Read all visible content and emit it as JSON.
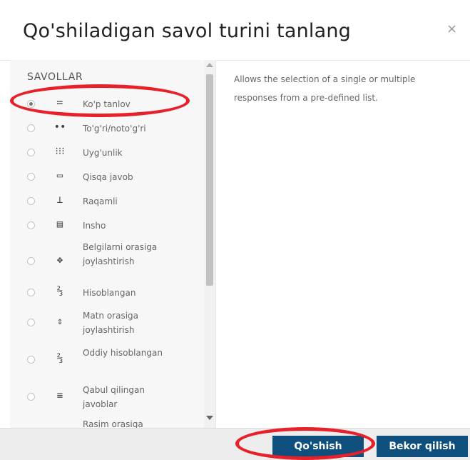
{
  "dialog": {
    "title": "Qo'shiladigan savol turini tanlang",
    "close_icon": "×"
  },
  "options_section": {
    "label": "SAVOLLAR",
    "items": [
      {
        "label": "Ko'p tanlov",
        "icon": "≔",
        "selected": true
      },
      {
        "label": "To'g'ri/noto'g'ri",
        "icon": "••",
        "selected": false
      },
      {
        "label": "Uyg'unlik",
        "icon": "⁝⁝⁝",
        "selected": false
      },
      {
        "label": "Qisqa javob",
        "icon": "▭",
        "selected": false
      },
      {
        "label": "Raqamli",
        "icon": "⊥",
        "selected": false
      },
      {
        "label": "Insho",
        "icon": "▤",
        "selected": false
      },
      {
        "label": "Belgilarni orasiga joylashtirish",
        "icon": "✥",
        "selected": false
      },
      {
        "label": "Hisoblangan",
        "icon": "⅔",
        "selected": false
      },
      {
        "label": "Matn orasiga joylashtirish",
        "icon": "⇕",
        "selected": false
      },
      {
        "label": "Oddiy hisoblangan",
        "icon": "⅔",
        "selected": false
      },
      {
        "label": "Qabul qilingan javoblar",
        "icon": "≡",
        "selected": false
      },
      {
        "label": "Rasim orasiga",
        "icon": "",
        "selected": false
      }
    ]
  },
  "description": "Allows the selection of a single or multiple responses from a pre-defined list.",
  "footer": {
    "add_label": "Qo'shish",
    "cancel_label": "Bekor qilish"
  },
  "colors": {
    "button_bg": "#0f4f7e",
    "highlight_ellipse": "#e8202a"
  }
}
